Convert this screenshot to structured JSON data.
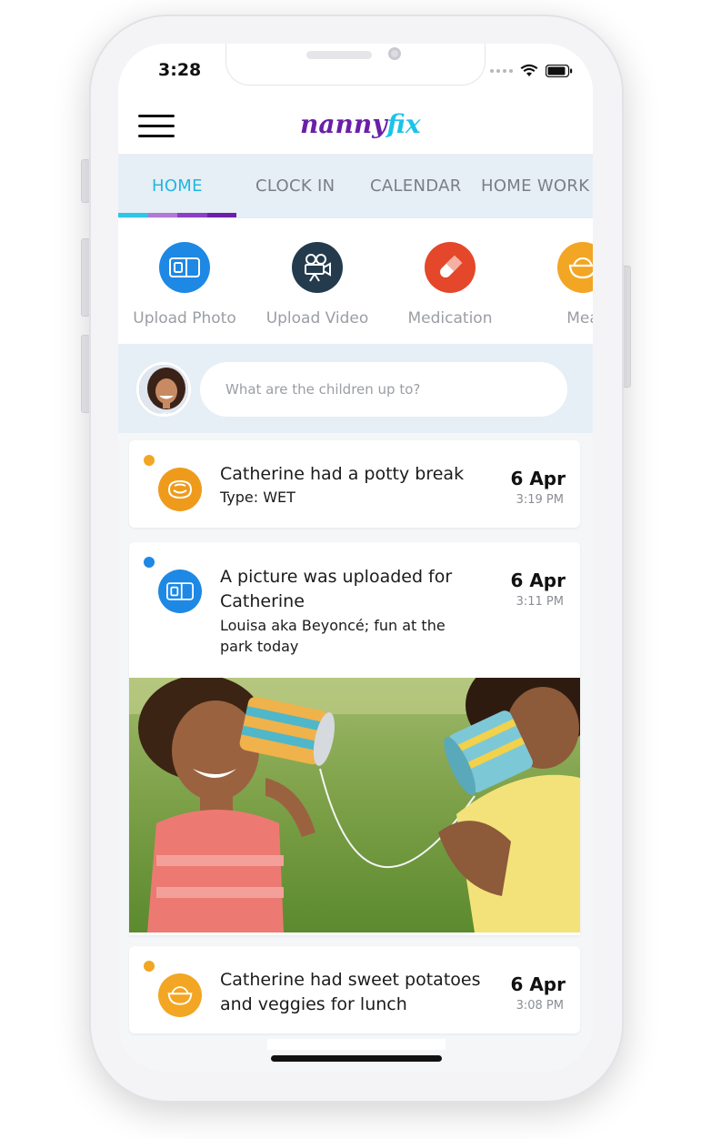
{
  "status_bar": {
    "time": "3:28"
  },
  "app": {
    "logo_part1": "nanny",
    "logo_part2": "fix"
  },
  "tabs": [
    {
      "label": "HOME",
      "active": true
    },
    {
      "label": "CLOCK IN",
      "active": false
    },
    {
      "label": "CALENDAR",
      "active": false
    },
    {
      "label": "HOME WORK",
      "active": false
    }
  ],
  "tab_underline_colors": [
    "#2ec5e8",
    "#b07ad6",
    "#8c3fc4",
    "#6a1fa8"
  ],
  "quick_actions": [
    {
      "label": "Upload Photo",
      "icon": "photo-icon",
      "color": "#1e88e5"
    },
    {
      "label": "Upload Video",
      "icon": "video-camera-icon",
      "color": "#243b4d"
    },
    {
      "label": "Medication",
      "icon": "pill-icon",
      "color": "#e4472a"
    },
    {
      "label": "Mea",
      "icon": "meal-bowl-icon",
      "color": "#f2a623"
    }
  ],
  "composer": {
    "placeholder": "What are the children up to?"
  },
  "feed": [
    {
      "title": "Catherine had a potty break",
      "subtitle": "Type: WET",
      "date": "6 Apr",
      "time": "3:19 PM",
      "icon": "potty-icon",
      "dot_color": "#f2a623",
      "icon_color": "#ee9b1c"
    },
    {
      "title": "A picture was uploaded for Catherine",
      "subtitle": "Louisa aka Beyoncé; fun at the park today",
      "date": "6 Apr",
      "time": "3:11 PM",
      "icon": "photo-icon",
      "dot_color": "#1e88e5",
      "icon_color": "#1e88e5"
    },
    {
      "title": "Catherine had sweet potatoes and veggies for lunch",
      "date": "6 Apr",
      "time": "3:08 PM",
      "icon": "meal-bowl-icon",
      "dot_color": "#f2a623",
      "icon_color": "#f2a623"
    }
  ]
}
